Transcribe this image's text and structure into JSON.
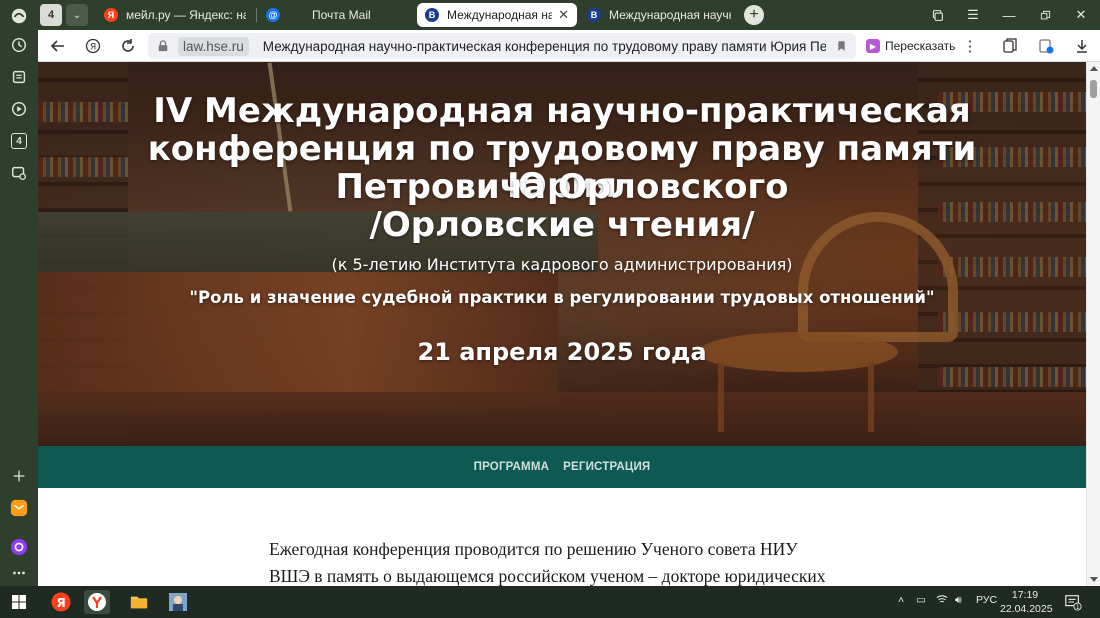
{
  "browser": {
    "tab_count": "4",
    "tabs": [
      {
        "title": "мейл.ру — Яндекс: нашлось",
        "favicon": "yandex-favicon",
        "active": false
      },
      {
        "title": "Почта Mail",
        "favicon": "mail-favicon",
        "active": false
      },
      {
        "title": "Международная научно-практическая",
        "favicon": "hse-favicon",
        "active": true
      },
      {
        "title": "Международная научно-практическая",
        "favicon": "hse-favicon",
        "active": false
      }
    ],
    "sidebar_badge": "4",
    "address": {
      "domain": "law.hse.ru",
      "page_title": "Международная научно-практическая конференция по трудовому праву памяти Юрия Петровича Орловского"
    },
    "retell_label": "Пересказать"
  },
  "page": {
    "hero": {
      "title_lines": [
        "IV Международная научно-практическая",
        "конференция по трудовому праву памяти Юрия",
        "Петровича Орловского",
        "/Орловские чтения/"
      ],
      "subtitle": "(к 5-летию Института кадрового администрирования)",
      "quote": "\"Роль и значение судебной практики в регулировании трудовых отношений\"",
      "date": "21 апреля 2025 года"
    },
    "nav": {
      "program": "ПРОГРАММА",
      "registration": "РЕГИСТРАЦИЯ"
    },
    "intro_lines": [
      "Ежегодная конференция проводится по решению Ученого совета НИУ",
      "ВШЭ в память о выдающемся российском ученом – докторе юридических"
    ]
  },
  "taskbar": {
    "language": "РУС",
    "time": "17:19",
    "date": "22.04.2025",
    "notification_count": "1"
  },
  "colors": {
    "browser_chrome": "#2f3f2e",
    "nav_strip": "#0e5a53",
    "taskbar": "#1f2b22",
    "yandex_red": "#fc3f1d"
  }
}
